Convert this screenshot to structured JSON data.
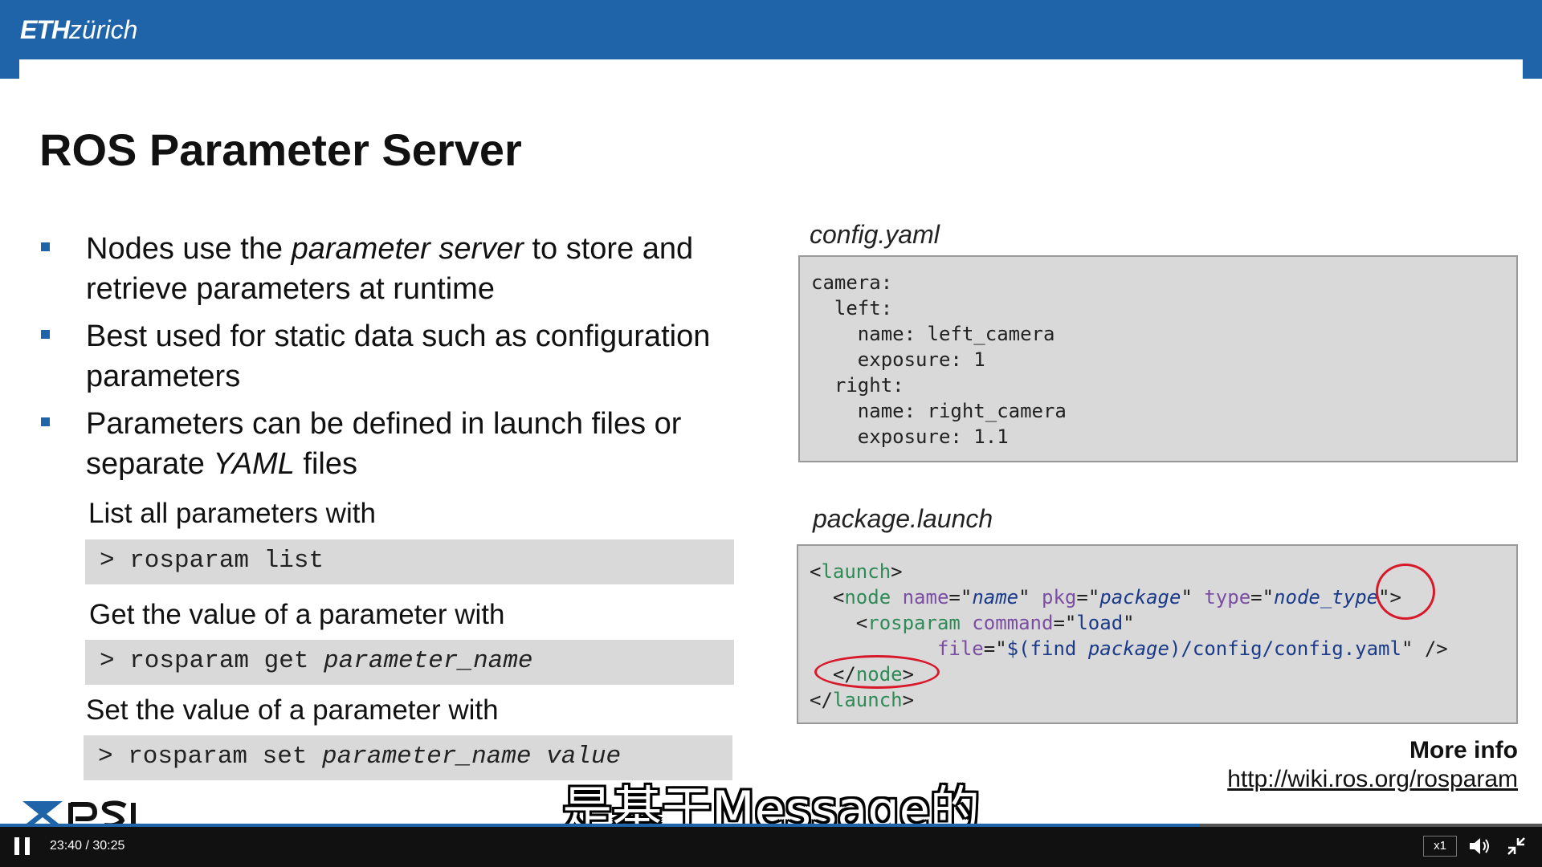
{
  "slide": {
    "logo": {
      "bold": "ETH",
      "light": "zürich"
    },
    "title": "ROS Parameter Server",
    "bullets": [
      {
        "pre": "Nodes use the ",
        "em": "parameter server",
        "post": " to store and retrieve parameters at runtime"
      },
      {
        "pre": "Best used for static data such as configuration parameters",
        "em": "",
        "post": ""
      },
      {
        "pre": "Parameters can be defined in launch files or separate ",
        "em": "YAML",
        "post": " files"
      }
    ],
    "commands": [
      {
        "label": "List all parameters with",
        "cmd": "> rosparam list",
        "arg": ""
      },
      {
        "label": "Get the value of a parameter with",
        "cmd": "> rosparam get ",
        "arg": "parameter_name"
      },
      {
        "label": "Set the value of a parameter with",
        "cmd": "> rosparam set ",
        "arg": "parameter_name value"
      }
    ],
    "config_label": "config.yaml",
    "config_lines": [
      "camera:",
      "  left:",
      "    name: left_camera",
      "    exposure: 1",
      "  right:",
      "    name: right_camera",
      "    exposure: 1.1"
    ],
    "launch_label": "package.launch",
    "launch": {
      "l1_open": "<",
      "l1_tag": "launch",
      "l1_close": ">",
      "l2_open": "<",
      "l2_tag": "node",
      "a_name": "name",
      "v_name": "name",
      "a_pkg": "pkg",
      "v_pkg": "package",
      "a_type": "type",
      "v_type": "node_type",
      "l2_close": ">",
      "l3_open": "<",
      "l3_tag": "rosparam",
      "a_command": "command",
      "v_command": "load",
      "a_file": "file",
      "v_file_pre": "$(find ",
      "v_file_pkg": "package",
      "v_file_post": ")/config/config.yaml",
      "l4_end": " />",
      "l5_open": "</",
      "l5_tag": "node",
      "l5_close": ">",
      "l6_open": "</",
      "l6_tag": "launch",
      "l6_close": ">"
    },
    "more_info": "More info",
    "more_link": "http://wiki.ros.org/rosparam"
  },
  "subtitle": "是基于Message的",
  "player": {
    "time": "23:40 / 30:25",
    "progress": 0.7781,
    "speed": "x1"
  },
  "colors": {
    "brand": "#1f64a8",
    "annotation": "#d8192a"
  }
}
